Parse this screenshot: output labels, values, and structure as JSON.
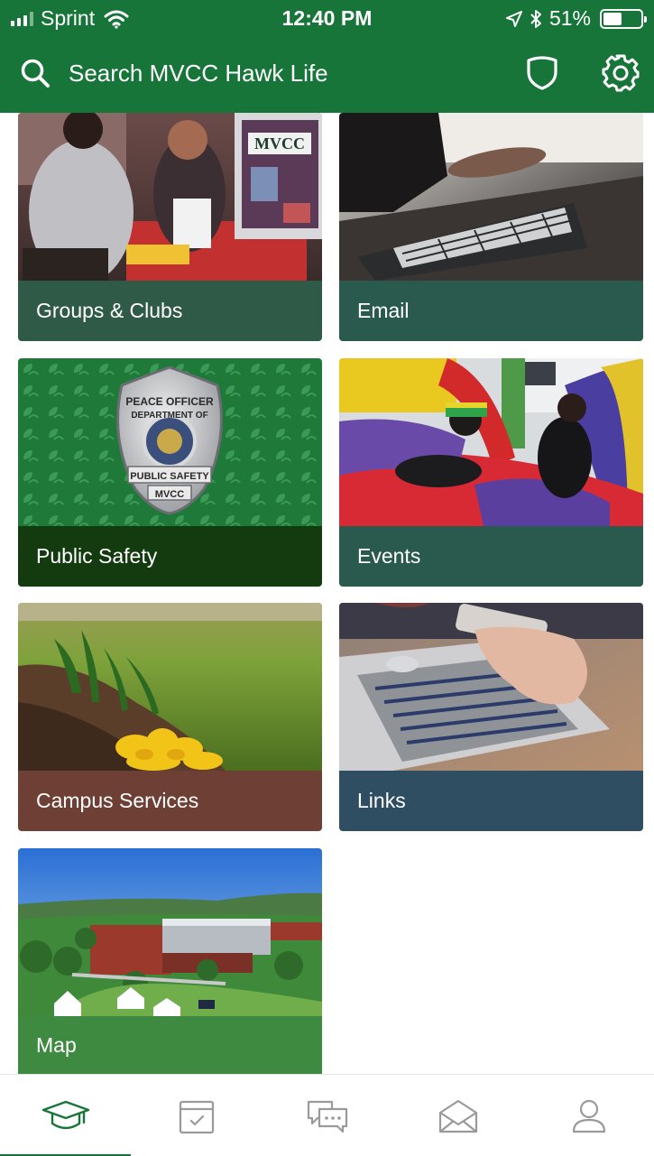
{
  "status_bar": {
    "carrier": "Sprint",
    "time": "12:40 PM",
    "battery": "51%",
    "battery_level": 0.51
  },
  "header": {
    "search_placeholder": "Search MVCC Hawk Life",
    "search_icon": "search-icon",
    "shield_icon": "shield-icon",
    "settings_icon": "gear-icon",
    "color": "#17753a"
  },
  "tiles": [
    {
      "label": "Groups & Clubs",
      "color": "#2f5a48"
    },
    {
      "label": "Email",
      "color": "#2a5a4e"
    },
    {
      "label": "Public Safety",
      "color": "#143b10"
    },
    {
      "label": "Events",
      "color": "#2a5a4e"
    },
    {
      "label": "Campus Services",
      "color": "#6e3f34"
    },
    {
      "label": "Links",
      "color": "#2f4e62"
    },
    {
      "label": "Map",
      "color": "#3f8a41"
    }
  ],
  "badge": {
    "line1": "PEACE OFFICER",
    "line2": "DEPARTMENT OF",
    "line3": "PUBLIC SAFETY",
    "line4": "MVCC"
  },
  "booth_sign": "MVCC",
  "tabbar": {
    "items": [
      {
        "icon": "graduation-cap-icon",
        "selected": true
      },
      {
        "icon": "calendar-check-icon",
        "selected": false
      },
      {
        "icon": "chat-bubbles-icon",
        "selected": false
      },
      {
        "icon": "envelope-icon",
        "selected": false
      },
      {
        "icon": "profile-icon",
        "selected": false
      }
    ],
    "active_color": "#17753a",
    "inactive_color": "#9a9a9a"
  }
}
